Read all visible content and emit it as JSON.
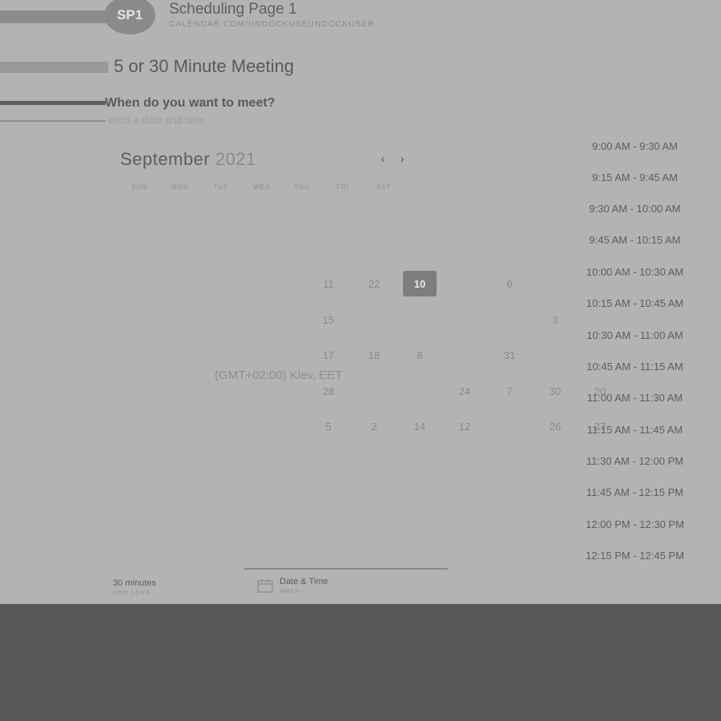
{
  "header": {
    "badge": "SP1",
    "title": "Scheduling Page 1",
    "url": "CALENDAR.COM/UNDOCKUSEUNDOCKUSER"
  },
  "event": {
    "title": "5 or 30 Minute Meeting",
    "question": "When do you want to meet?",
    "subtitle": "elect a date and time"
  },
  "calendar": {
    "month": "September",
    "year": "2021",
    "prev_icon": "‹",
    "next_icon": "›",
    "weekdays": [
      "SUN",
      "MON",
      "TUE",
      "WED",
      "THU",
      "FRI",
      "SAT"
    ],
    "days": [
      "11",
      "22",
      "10",
      "6",
      "15",
      "3",
      "17",
      "18",
      "8",
      "31",
      "28",
      "24",
      "7",
      "30",
      "20",
      "5",
      "2",
      "14",
      "12",
      "26",
      "27"
    ],
    "selected_day": "10",
    "timezone": "(GMT+02:00) Kiev, EET"
  },
  "time_slots": [
    "9:00 AM - 9:30 AM",
    "9:15 AM - 9:45 AM",
    "9:30 AM - 10:00 AM",
    "9:45 AM - 10:15 AM",
    "10:00 AM - 10:30 AM",
    "10:15 AM - 10:45 AM",
    "10:30 AM - 11:00 AM",
    "10:45 AM - 11:15 AM",
    "11:00 AM - 11:30 AM",
    "11:15 AM - 11:45 AM",
    "11:30 AM - 12:00 PM",
    "11:45 AM - 12:15 PM",
    "12:00 PM - 12:30 PM",
    "12:15 PM - 12:45 PM"
  ],
  "footer": {
    "duration": "30 minutes",
    "duration_label": "HOW LONG",
    "datetime": "Date & Time",
    "datetime_label": "WHEN",
    "calendar_icon": "calendar-icon"
  },
  "colors": {
    "page_bg": "#b3b3b3",
    "outer_bg": "#575757",
    "selected": "#7d7d7d"
  }
}
